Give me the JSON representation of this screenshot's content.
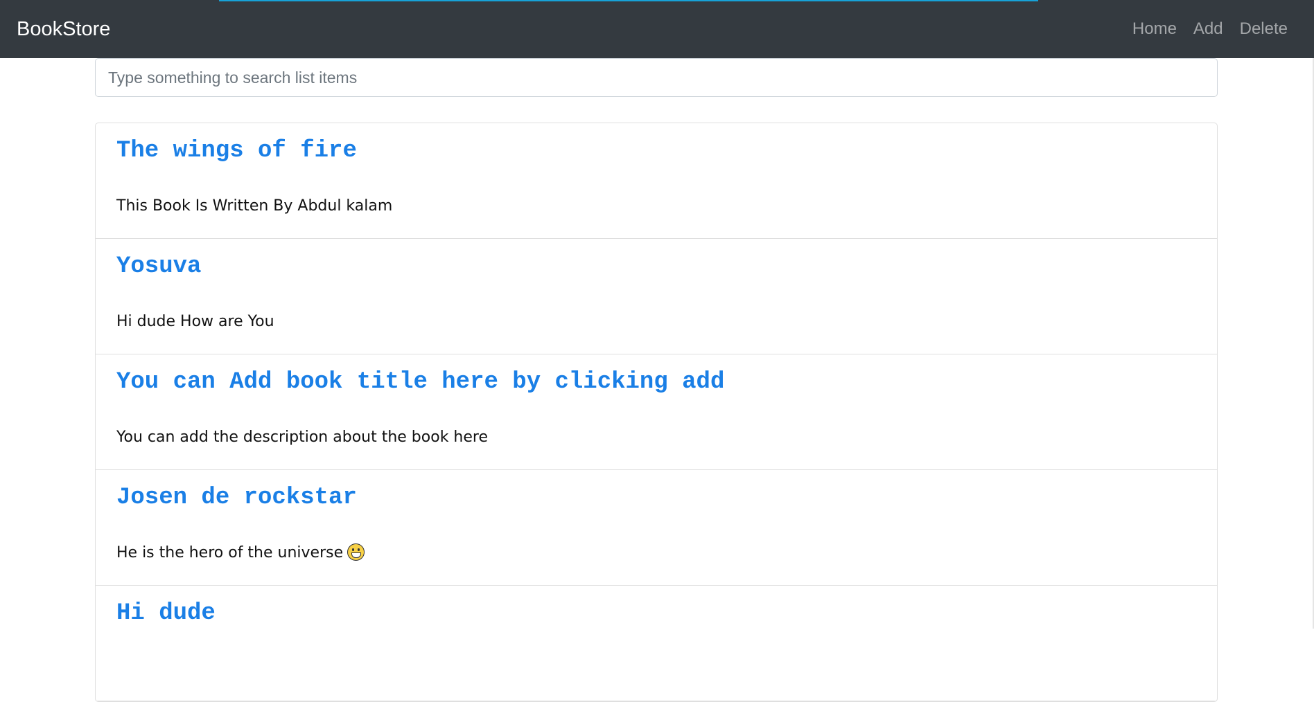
{
  "navbar": {
    "brand": "BookStore",
    "links": [
      {
        "label": "Home"
      },
      {
        "label": "Add"
      },
      {
        "label": "Delete"
      }
    ]
  },
  "search": {
    "placeholder": "Type something to search list items",
    "value": ""
  },
  "books": [
    {
      "title": "The wings of fire",
      "description": "This Book Is Written By Abdul kalam"
    },
    {
      "title": "Yosuva",
      "description": "Hi dude How are You"
    },
    {
      "title": "You can Add book title here by clicking add",
      "description": "You can add the description about the book here"
    },
    {
      "title": "Josen de rockstar",
      "description": "He is the hero of the universe",
      "emoji": "grinning-face-icon"
    },
    {
      "title": "Hi dude",
      "description": ""
    }
  ],
  "colors": {
    "navbar_bg": "#343a40",
    "title_link": "#1a7fe6",
    "accent_bar": "#17a2d8"
  }
}
